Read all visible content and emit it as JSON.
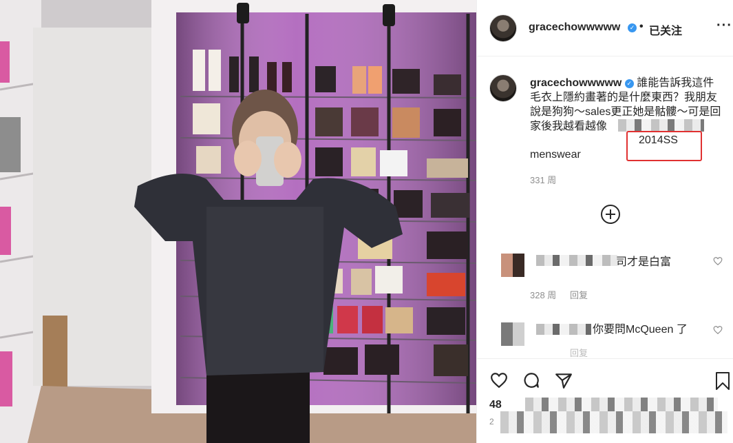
{
  "header": {
    "username": "gracechowwwww",
    "dot": "•",
    "follow_label": "已关注",
    "more_label": "···"
  },
  "caption": {
    "username": "gracechowwwww",
    "text": "誰能告訴我這件毛衣上隱約畫著的是什麼東西？我朋友說是狗狗～sales更正她是骷髏～可是回家後我越看越像",
    "highlight": "2014SS",
    "tag": "menswear",
    "time": "331 周"
  },
  "comments": [
    {
      "text": "司才是白富",
      "time": "328 周",
      "reply": "回复"
    },
    {
      "text": "你要問McQueen 了",
      "time": "",
      "reply": "回复"
    }
  ],
  "footer": {
    "likes": "48",
    "ago": "2"
  },
  "colors": {
    "verified": "#3897f0",
    "annotation": "#e03030",
    "closet_purple": "#b46fc0"
  },
  "icons": [
    "heart-icon",
    "comment-icon",
    "share-icon",
    "bookmark-icon",
    "add-icon",
    "more-icon",
    "verified-icon"
  ]
}
